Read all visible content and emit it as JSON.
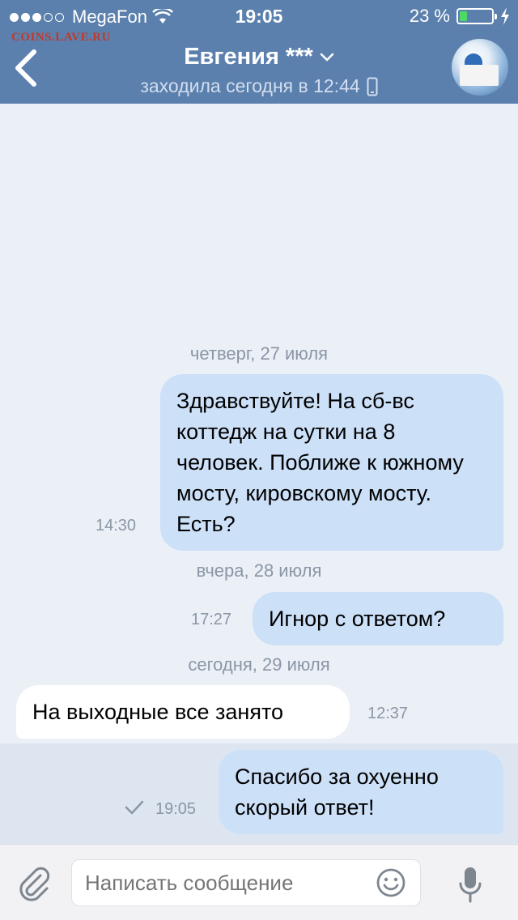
{
  "status_bar": {
    "carrier": "MegaFon",
    "time": "19:05",
    "battery_percent_text": "23 %",
    "battery_level": 0.23
  },
  "watermark": "COINS.LAVE.RU",
  "header": {
    "name": "Евгения ***",
    "last_seen": "заходила сегодня в 12:44"
  },
  "messages": [
    {
      "type": "date",
      "text": "четверг, 27 июля"
    },
    {
      "type": "out",
      "text": "Здравствуйте! На сб-вс коттедж на сутки на 8 человек. Поближе к южному мосту, кировскому мосту. Есть?",
      "time": "14:30"
    },
    {
      "type": "date",
      "text": "вчера, 28 июля"
    },
    {
      "type": "out",
      "text": "Игнор с ответом?",
      "time": "17:27"
    },
    {
      "type": "date",
      "text": "сегодня, 29 июля"
    },
    {
      "type": "in",
      "text": "На выходные все занято",
      "time": "12:37"
    },
    {
      "type": "out",
      "text": "Спасибо за охуенно скорый ответ!",
      "time": "19:05",
      "status": "sent"
    }
  ],
  "input": {
    "placeholder": "Написать сообщение"
  },
  "colors": {
    "header_bg": "#5b80ad",
    "outgoing_bubble": "#cce0f8",
    "incoming_bubble": "#ffffff",
    "chat_bg": "#ebf0f7"
  }
}
